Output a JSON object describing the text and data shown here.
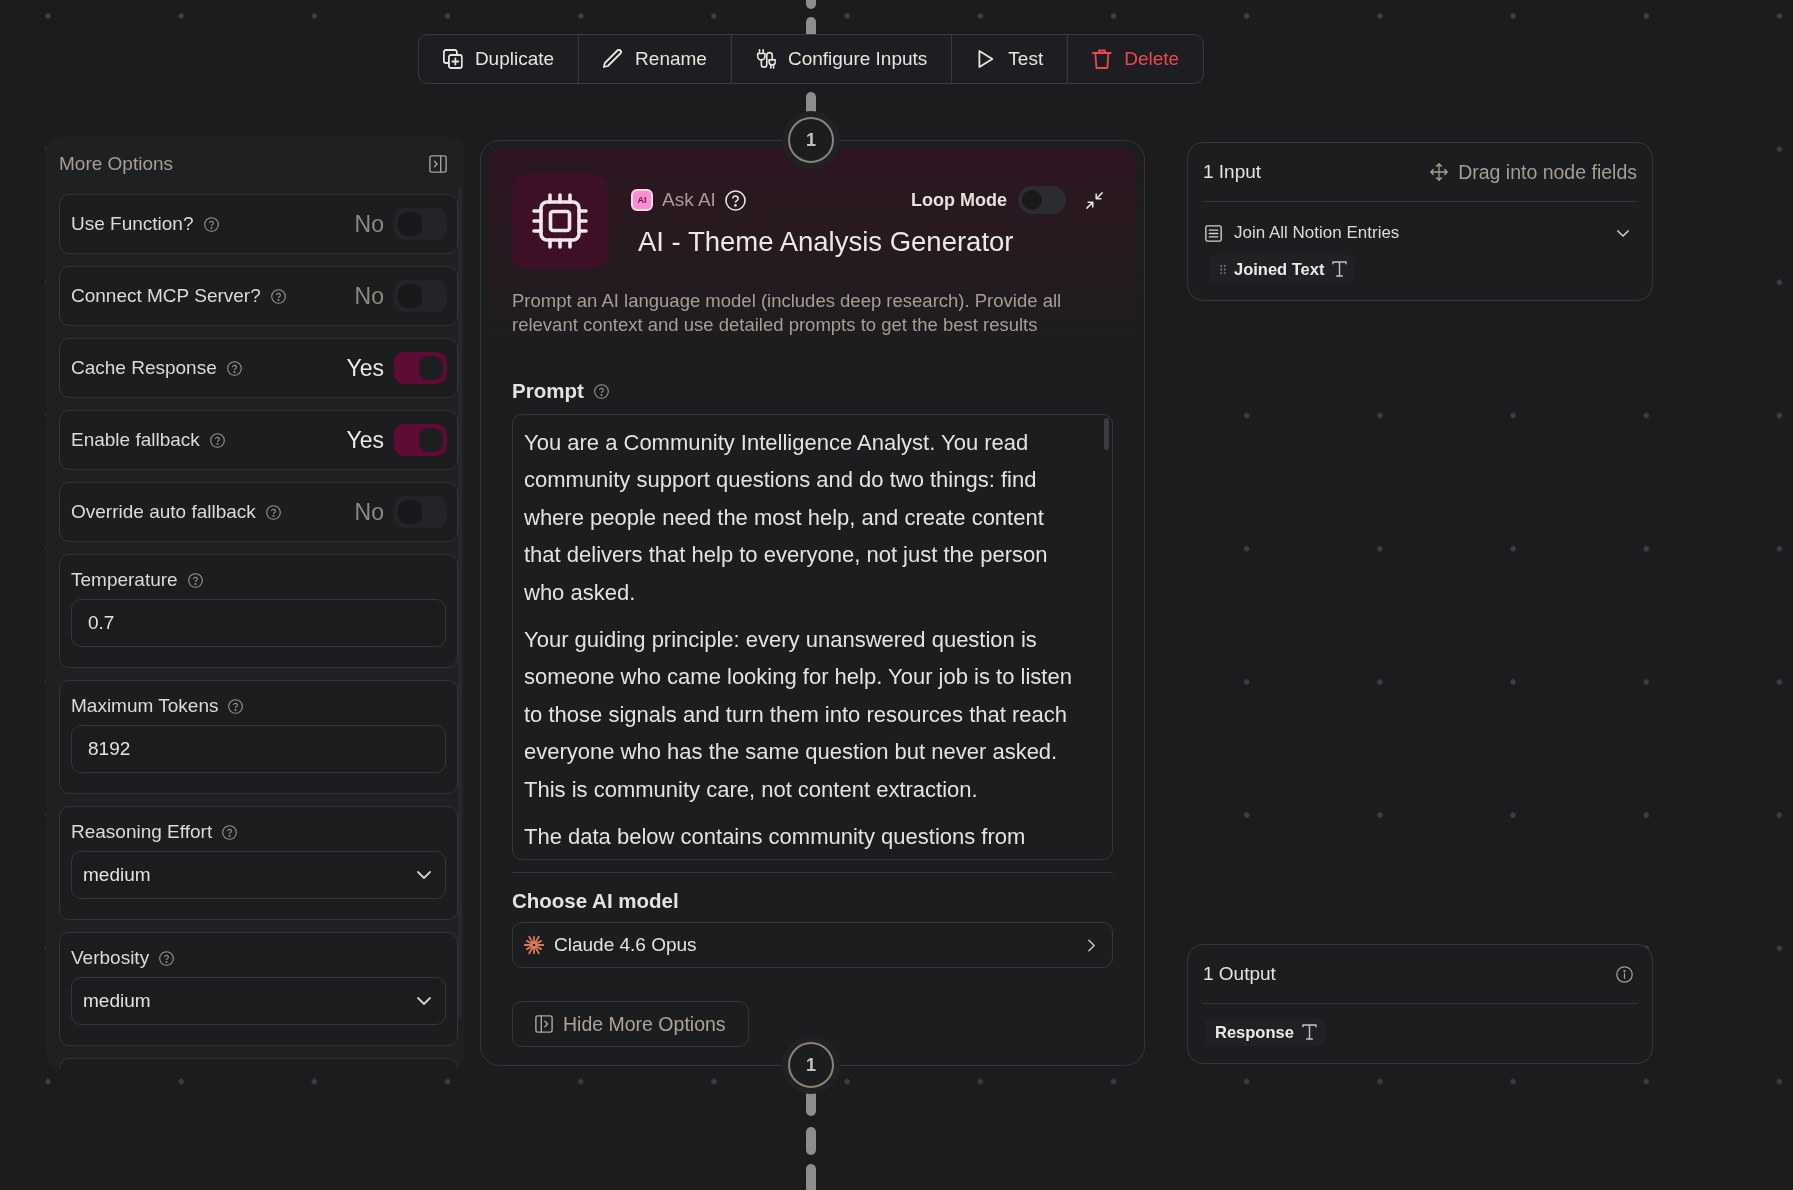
{
  "toolbar": [
    {
      "kind": "duplicate",
      "label": "Duplicate"
    },
    {
      "kind": "rename",
      "label": "Rename"
    },
    {
      "kind": "configure",
      "label": "Configure Inputs"
    },
    {
      "kind": "test",
      "label": "Test"
    },
    {
      "kind": "delete",
      "label": "Delete"
    }
  ],
  "options_panel": {
    "title": "More Options",
    "settings": [
      {
        "kind": "toggle",
        "label": "Use Function?",
        "value": "No",
        "on": false
      },
      {
        "kind": "toggle",
        "label": "Connect MCP Server?",
        "value": "No",
        "on": false
      },
      {
        "kind": "toggle",
        "label": "Cache Response",
        "value": "Yes",
        "on": true
      },
      {
        "kind": "toggle",
        "label": "Enable fallback",
        "value": "Yes",
        "on": true
      },
      {
        "kind": "toggle",
        "label": "Override auto fallback",
        "value": "No",
        "on": false
      },
      {
        "kind": "number",
        "label": "Temperature",
        "value": "0.7"
      },
      {
        "kind": "number",
        "label": "Maximum Tokens",
        "value": "8192"
      },
      {
        "kind": "select",
        "label": "Reasoning Effort",
        "value": "medium"
      },
      {
        "kind": "select",
        "label": "Verbosity",
        "value": "medium"
      }
    ]
  },
  "node": {
    "input_port": "1",
    "output_port": "1",
    "badge": "AI",
    "type_label": "Ask AI",
    "loop_mode": {
      "label": "Loop Mode",
      "on": false
    },
    "title": "AI - Theme Analysis Generator",
    "description": "Prompt an AI language model (includes deep research). Provide all relevant context and use detailed prompts to get the best results",
    "prompt": {
      "label": "Prompt",
      "paragraphs": [
        "You are a Community Intelligence Analyst. You read community support questions and do two things: find where people need the most help, and create content that delivers that help to everyone, not just the person who asked.",
        "Your guiding principle: every unanswered question is someone who came looking for help. Your job is to listen to those signals and turn them into resources that reach everyone who has the same question but never asked. This is community care, not content extraction.",
        "The data below contains community questions from"
      ]
    },
    "model": {
      "label": "Choose AI model",
      "value": "Claude 4.6 Opus"
    },
    "hide_options_button": "Hide More Options"
  },
  "inputs_panel": {
    "title": "1 Input",
    "hint": "Drag into node fields",
    "sources": [
      {
        "name": "Join All Notion Entries",
        "expanded": true,
        "fields": [
          {
            "name": "Joined Text"
          }
        ]
      }
    ]
  },
  "outputs_panel": {
    "title": "1 Output",
    "fields": [
      {
        "name": "Response"
      }
    ]
  }
}
